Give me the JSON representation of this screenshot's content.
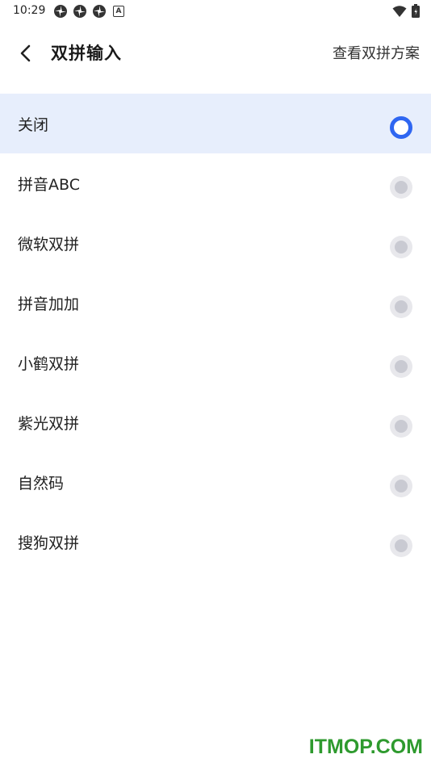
{
  "status_bar": {
    "time": "10:29",
    "left_icons": [
      "pinwheel-icon",
      "pinwheel-icon",
      "pinwheel-icon",
      "a-badge-icon"
    ],
    "a_badge": "A",
    "right_icons": [
      "wifi-icon",
      "battery-icon"
    ]
  },
  "header": {
    "title": "双拼输入",
    "action_label": "查看双拼方案"
  },
  "options": [
    {
      "label": "关闭",
      "selected": true
    },
    {
      "label": "拼音ABC",
      "selected": false
    },
    {
      "label": "微软双拼",
      "selected": false
    },
    {
      "label": "拼音加加",
      "selected": false
    },
    {
      "label": "小鹤双拼",
      "selected": false
    },
    {
      "label": "紫光双拼",
      "selected": false
    },
    {
      "label": "自然码",
      "selected": false
    },
    {
      "label": "搜狗双拼",
      "selected": false
    }
  ],
  "watermark": "ITMOP.COM",
  "colors": {
    "accent": "#2f66f1",
    "selected_row_bg": "#e7eefc",
    "radio_off_outer": "#e8e8ec",
    "radio_off_inner": "#c9cad2",
    "watermark": "#2e9a2e"
  }
}
